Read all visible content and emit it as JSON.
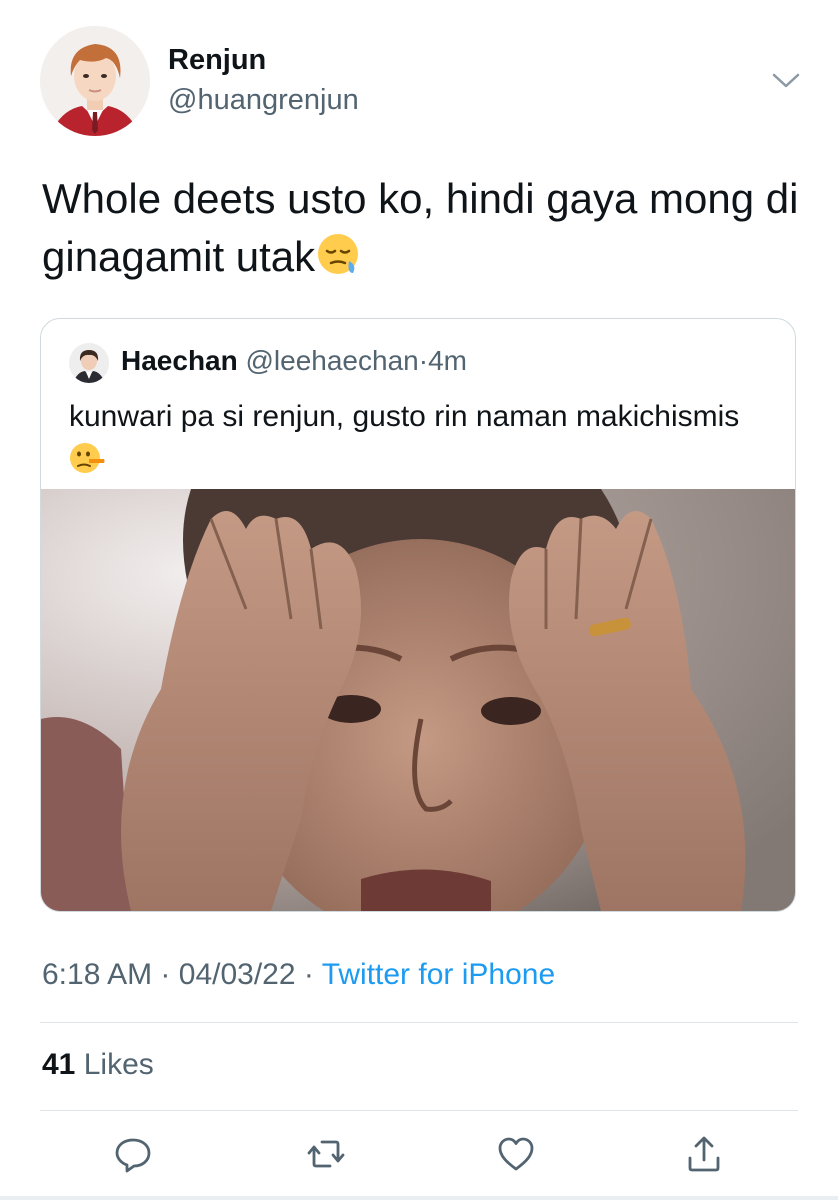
{
  "author": {
    "display_name": "Renjun",
    "handle": "@huangrenjun",
    "avatar_icon": "profile-photo"
  },
  "tweet": {
    "text": "Whole deets usto ko, hindi gaya mong di ginagamit utak",
    "emoji": "sleepy-face-emoji"
  },
  "quoted_tweet": {
    "display_name": "Haechan",
    "handle": "@leehaechan",
    "separator": "·",
    "time": "4m",
    "text": "kunwari pa si renjun, gusto rin naman makichismis",
    "emoji": "lying-face-emoji",
    "image": "stressed-woman-holding-head-photo"
  },
  "meta": {
    "time": "6:18 AM",
    "separator1": "·",
    "date": "04/03/22",
    "separator2": "·",
    "source": "Twitter for iPhone"
  },
  "stats": {
    "likes_count": "41",
    "likes_label": "Likes"
  },
  "actions": [
    "reply-icon",
    "retweet-icon",
    "like-icon",
    "share-icon"
  ],
  "colors": {
    "link": "#1d9bf0",
    "secondary_text": "#536471",
    "primary_text": "#0f1419",
    "border": "#cfd9de"
  }
}
